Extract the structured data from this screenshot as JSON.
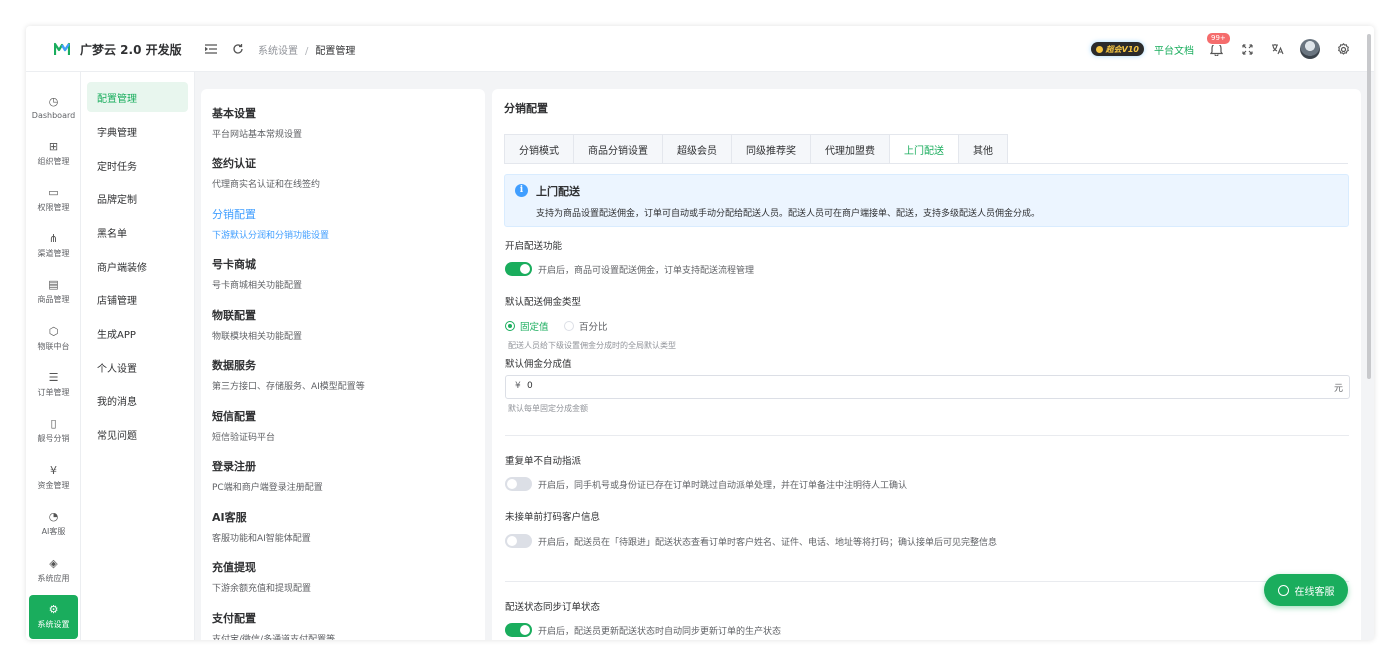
{
  "app": {
    "brand": "广梦云 2.0 开发版"
  },
  "header": {
    "breadcrumb": [
      "系统设置",
      "配置管理"
    ],
    "vip_label": "超会V10",
    "docs_link": "平台文档",
    "notification_count": "99+"
  },
  "rail": {
    "items": [
      {
        "label": "Dashboard",
        "icon": "dashboard-icon"
      },
      {
        "label": "组织管理",
        "icon": "grid-icon"
      },
      {
        "label": "权限管理",
        "icon": "monitor-icon"
      },
      {
        "label": "渠道管理",
        "icon": "network-icon"
      },
      {
        "label": "商品管理",
        "icon": "shop-icon"
      },
      {
        "label": "物联中台",
        "icon": "cube-icon"
      },
      {
        "label": "订单管理",
        "icon": "list-icon"
      },
      {
        "label": "靓号分销",
        "icon": "phone-icon"
      },
      {
        "label": "资金管理",
        "icon": "money-icon"
      },
      {
        "label": "AI客服",
        "icon": "ai-icon"
      },
      {
        "label": "系统应用",
        "icon": "package-icon"
      },
      {
        "label": "系统设置",
        "icon": "settings-icon",
        "active": true
      }
    ]
  },
  "submenu": {
    "items": [
      "配置管理",
      "字典管理",
      "定时任务",
      "品牌定制",
      "黑名单",
      "商户端装修",
      "店铺管理",
      "生成APP",
      "个人设置",
      "我的消息",
      "常见问题"
    ],
    "active_index": 0
  },
  "config_list": [
    {
      "title": "基本设置",
      "desc": "平台网站基本常规设置"
    },
    {
      "title": "签约认证",
      "desc": "代理商实名认证和在线签约"
    },
    {
      "title": "分销配置",
      "desc": "下游默认分润和分销功能设置",
      "active": true
    },
    {
      "title": "号卡商城",
      "desc": "号卡商城相关功能配置"
    },
    {
      "title": "物联配置",
      "desc": "物联模块相关功能配置"
    },
    {
      "title": "数据服务",
      "desc": "第三方接口、存储服务、AI模型配置等"
    },
    {
      "title": "短信配置",
      "desc": "短信验证码平台"
    },
    {
      "title": "登录注册",
      "desc": "PC端和商户端登录注册配置"
    },
    {
      "title": "AI客服",
      "desc": "客服功能和AI智能体配置"
    },
    {
      "title": "充值提现",
      "desc": "下游余额充值和提现配置"
    },
    {
      "title": "支付配置",
      "desc": "支付宝/微信/多通道支付配置等"
    }
  ],
  "main": {
    "title": "分销配置",
    "tabs": [
      "分销模式",
      "商品分销设置",
      "超级会员",
      "同级推荐奖",
      "代理加盟费",
      "上门配送",
      "其他"
    ],
    "active_tab": 5,
    "alert": {
      "title": "上门配送",
      "desc": "支持为商品设置配送佣金，订单可自动或手动分配给配送人员。配送人员可在商户端接单、配送，支持多级配送人员佣金分成。"
    },
    "enable_delivery": {
      "label": "开启配送功能",
      "on": true,
      "hint": "开启后，商品可设置配送佣金，订单支持配送流程管理"
    },
    "commission_type": {
      "label": "默认配送佣金类型",
      "options": [
        "固定值",
        "百分比"
      ],
      "selected": 0,
      "hint": "配送人员给下级设置佣金分成时的全局默认类型"
    },
    "commission_value": {
      "label": "默认佣金分成值",
      "prefix": "¥",
      "value": "0",
      "suffix": "元",
      "hint": "默认每单固定分成金额"
    },
    "no_auto_dispatch": {
      "label": "重复单不自动指派",
      "on": false,
      "hint": "开启后，同手机号或身份证已存在订单时跳过自动派单处理，并在订单备注中注明待人工确认"
    },
    "mask_customer": {
      "label": "未接单前打码客户信息",
      "on": false,
      "hint": "开启后，配送员在「待跟进」配送状态查看订单时客户姓名、证件、电话、地址等将打码；确认接单后可见完整信息"
    },
    "sync_status": {
      "label": "配送状态同步订单状态",
      "on": true,
      "hint": "开启后，配送员更新配送状态时自动同步更新订单的生产状态"
    }
  },
  "chat_button": "在线客服",
  "colors": {
    "primary": "#1aad5d",
    "link": "#409eff",
    "danger": "#f56c6c"
  }
}
